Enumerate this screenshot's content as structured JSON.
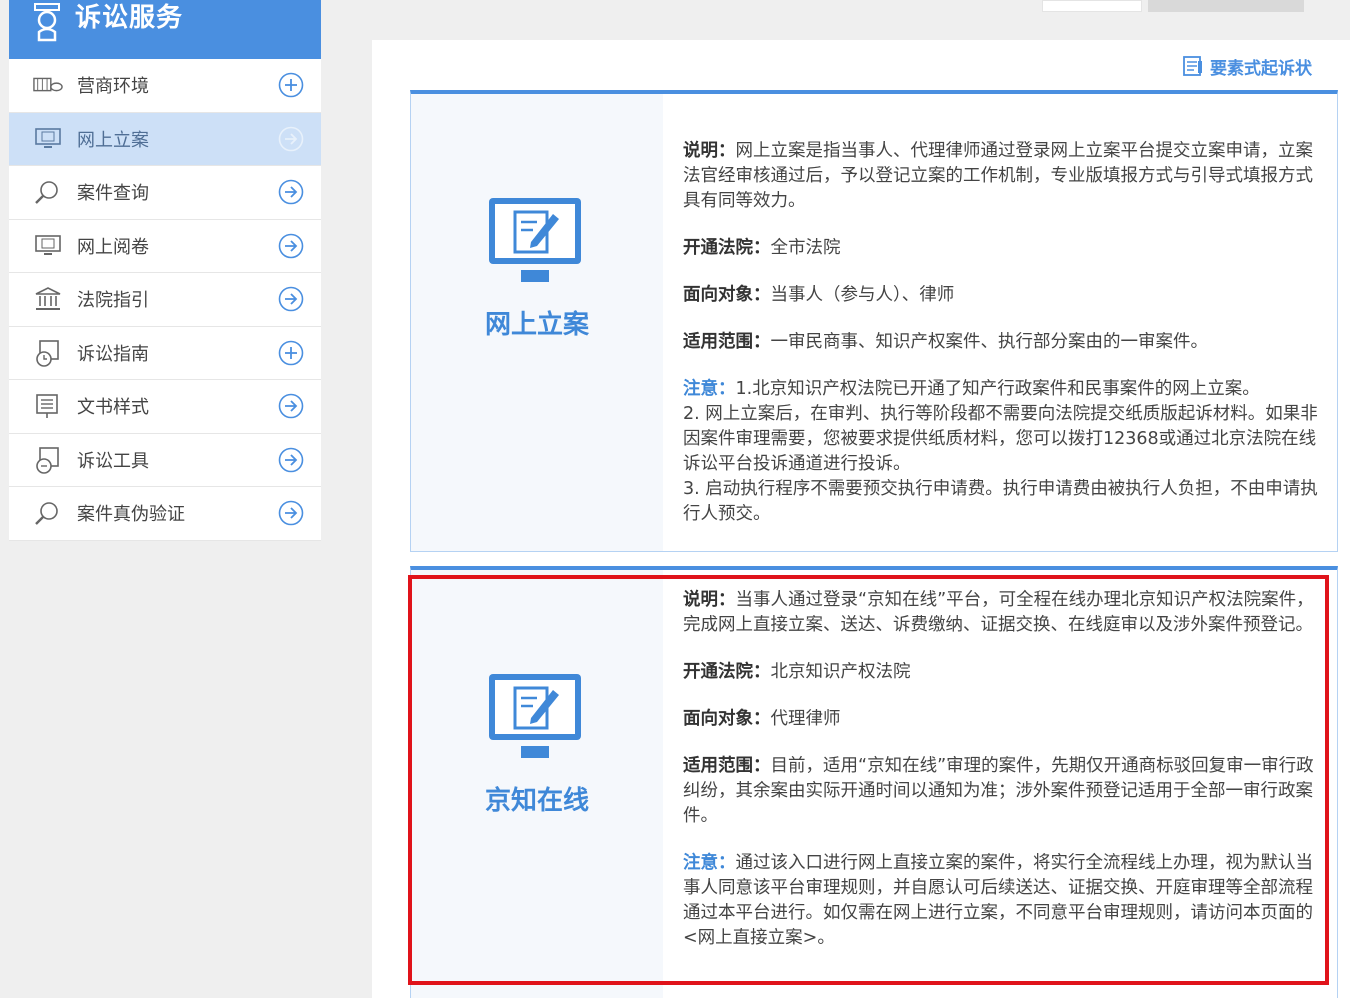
{
  "sidebar": {
    "title": "诉讼服务",
    "items": [
      {
        "label": "营商环境",
        "icon": "business-icon",
        "action": "plus"
      },
      {
        "label": "网上立案",
        "icon": "online-filing-icon",
        "action": "arrow",
        "active": true
      },
      {
        "label": "案件查询",
        "icon": "case-search-icon",
        "action": "arrow"
      },
      {
        "label": "网上阅卷",
        "icon": "online-review-icon",
        "action": "arrow"
      },
      {
        "label": "法院指引",
        "icon": "court-guide-icon",
        "action": "arrow"
      },
      {
        "label": "诉讼指南",
        "icon": "litigation-guide-icon",
        "action": "plus"
      },
      {
        "label": "文书样式",
        "icon": "document-template-icon",
        "action": "arrow"
      },
      {
        "label": "诉讼工具",
        "icon": "litigation-tools-icon",
        "action": "arrow"
      },
      {
        "label": "案件真伪验证",
        "icon": "case-verify-icon",
        "action": "arrow"
      }
    ]
  },
  "main": {
    "element_link": "要素式起诉状",
    "cards": [
      {
        "title": "网上立案",
        "desc_label": "说明：",
        "desc": "网上立案是指当事人、代理律师通过登录网上立案平台提交立案申请，立案法官经审核通过后，予以登记立案的工作机制，专业版填报方式与引导式填报方式具有同等效力。",
        "court_label": "开通法院：",
        "court": "全市法院",
        "target_label": "面向对象：",
        "target": "当事人（参与人）、律师",
        "scope_label": "适用范围：",
        "scope": "一审民商事、知识产权案件、执行部分案由的一审案件。",
        "note_label": "注意：",
        "note_lines": [
          "1.北京知识产权法院已开通了知产行政案件和民事案件的网上立案。",
          "2. 网上立案后，在审判、执行等阶段都不需要向法院提交纸质版起诉材料。如果非因案件审理需要，您被要求提供纸质材料，您可以拨打12368或通过北京法院在线诉讼平台投诉通道进行投诉。",
          "3. 启动执行程序不需要预交执行申请费。执行申请费由被执行人负担，不由申请执行人预交。"
        ]
      },
      {
        "title": "京知在线",
        "desc_label": "说明：",
        "desc": "当事人通过登录“京知在线”平台，可全程在线办理北京知识产权法院案件，完成网上直接立案、送达、诉费缴纳、证据交换、在线庭审以及涉外案件预登记。",
        "court_label": "开通法院：",
        "court": "北京知识产权法院",
        "target_label": "面向对象：",
        "target": "代理律师",
        "scope_label": "适用范围：",
        "scope": "目前，适用“京知在线”审理的案件，先期仅开通商标驳回复审一审行政纠纷，其余案由实际开通时间以通知为准；涉外案件预登记适用于全部一审行政案件。",
        "note_label": "注意：",
        "note_lines": [
          "通过该入口进行网上直接立案的案件，将实行全流程线上办理，视为默认当事人同意该平台审理规则，并自愿认可后续送达、证据交换、开庭审理等全部流程通过本平台进行。如仅需在网上进行立案，不同意平台审理规则，请访问本页面的<网上直接立案>。"
        ]
      }
    ]
  },
  "colors": {
    "accent": "#4a8fe0",
    "active_bg": "#cde0f7",
    "highlight": "#e0131a"
  }
}
